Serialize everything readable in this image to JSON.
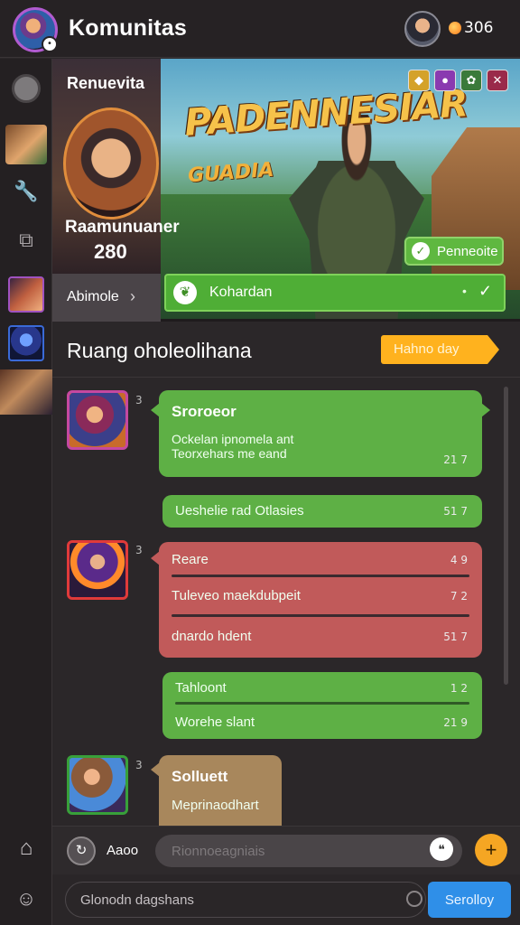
{
  "header": {
    "title": "Komunitas",
    "coins": "306",
    "coin_icon": "coin-icon"
  },
  "rail": {
    "icons": [
      "chat-round-icon",
      "game-thumb-icon",
      "wrench-icon",
      "puzzle-icon",
      "hero-thumb-icon",
      "mage-thumb-icon",
      "fighter-thumb-icon",
      "home-icon",
      "bot-icon"
    ]
  },
  "banner": {
    "profile_label": "Renuevita",
    "profile_name": "Raamunuaner",
    "profile_score": "280",
    "profile_action": "Abimole",
    "art_title": "PADENNESIAR",
    "art_subtitle": "GUADIA",
    "art_button": "Penneoite",
    "join_label": "Kohardan"
  },
  "section": {
    "title": "Ruang oholeolihana",
    "help_button": "Hahno day"
  },
  "messages": [
    {
      "num": "3",
      "title": "Sroroeor",
      "lines": [
        "Ockelan ipnomela ant",
        "Teorxehars me eand"
      ],
      "time": "21 7"
    },
    {
      "text": "Ueshelie rad Otlasies",
      "time": "51 7"
    },
    {
      "num": "3",
      "rows": [
        {
          "text": "Reare",
          "time": "4 9"
        },
        {
          "text": "Tuleveo maekdubpeit",
          "time": "7 2"
        },
        {
          "text": "dnardo hdent",
          "time": "51 7"
        }
      ]
    },
    {
      "rows": [
        {
          "text": "Tahloont",
          "time": "1 2"
        },
        {
          "text": "Worehe slant",
          "time": "21 9"
        }
      ]
    },
    {
      "num": "3",
      "title": "Solluett",
      "line": "Meprinaodhart"
    }
  ],
  "composer": {
    "label": "Aaoo",
    "placeholder": "Rionnoeagniais"
  },
  "bottom": {
    "placeholder": "Glonodn dagshans",
    "send_label": "Serolloy"
  },
  "colors": {
    "accent_green": "#5eb045",
    "accent_red": "#c15a5a",
    "accent_orange": "#ffb21e",
    "accent_blue": "#2f8fe8"
  }
}
